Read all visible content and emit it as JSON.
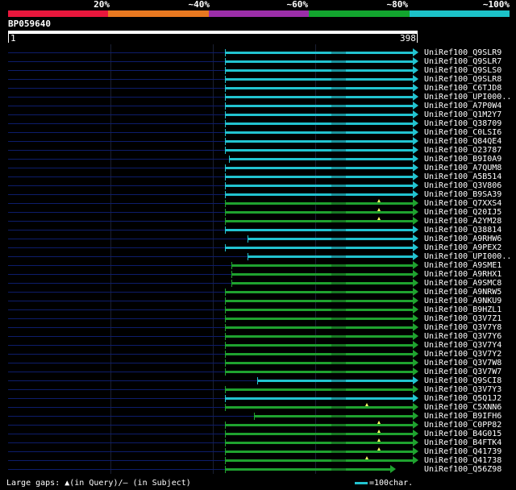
{
  "header": {
    "percent_labels": [
      "20%",
      "~40%",
      "~60%",
      "~80%",
      "~100%"
    ],
    "segment_colors": [
      "#e8173c",
      "#e87820",
      "#9b2ea8",
      "#12a52e",
      "#1cc2c8"
    ]
  },
  "query": {
    "id": "BP059640",
    "start": "1",
    "end": "398"
  },
  "colors": {
    "cyan": "#22c3d0",
    "green": "#1fa22f",
    "base": "#0d1d6b",
    "gap": "#ffff66"
  },
  "hits": [
    {
      "label": "UniRef100_Q9SLR9",
      "color": "cyan",
      "start": 0.53
    },
    {
      "label": "UniRef100_Q9SLR7",
      "color": "cyan",
      "start": 0.53
    },
    {
      "label": "UniRef100_Q9SLS0",
      "color": "cyan",
      "start": 0.53
    },
    {
      "label": "UniRef100_Q9SLR8",
      "color": "cyan",
      "start": 0.53
    },
    {
      "label": "UniRef100_C6TJD8",
      "color": "cyan",
      "start": 0.53
    },
    {
      "label": "UniRef100_UPI000..",
      "color": "cyan",
      "start": 0.53
    },
    {
      "label": "UniRef100_A7P0W4",
      "color": "cyan",
      "start": 0.53
    },
    {
      "label": "UniRef100_Q1M2Y7",
      "color": "cyan",
      "start": 0.53
    },
    {
      "label": "UniRef100_Q38709",
      "color": "cyan",
      "start": 0.53
    },
    {
      "label": "UniRef100_C0LSI6",
      "color": "cyan",
      "start": 0.53
    },
    {
      "label": "UniRef100_Q84QE4",
      "color": "cyan",
      "start": 0.53
    },
    {
      "label": "UniRef100_O23787",
      "color": "cyan",
      "start": 0.53
    },
    {
      "label": "UniRef100_B9I0A9",
      "color": "cyan",
      "start": 0.54
    },
    {
      "label": "UniRef100_A7QUM8",
      "color": "cyan",
      "start": 0.53
    },
    {
      "label": "UniRef100_A5B514",
      "color": "cyan",
      "start": 0.53
    },
    {
      "label": "UniRef100_Q3V806",
      "color": "cyan",
      "start": 0.53
    },
    {
      "label": "UniRef100_B9SA39",
      "color": "cyan",
      "start": 0.53
    },
    {
      "label": "UniRef100_Q7XXS4",
      "color": "green",
      "start": 0.53,
      "gap": 0.905
    },
    {
      "label": "UniRef100_Q20IJ5",
      "color": "green",
      "start": 0.53,
      "gap": 0.905
    },
    {
      "label": "UniRef100_A2YM28",
      "color": "green",
      "start": 0.53,
      "gap": 0.905
    },
    {
      "label": "UniRef100_Q38814",
      "color": "cyan",
      "start": 0.53
    },
    {
      "label": "UniRef100_A9RHW6",
      "color": "cyan",
      "start": 0.585
    },
    {
      "label": "UniRef100_A9PEX2",
      "color": "cyan",
      "start": 0.53
    },
    {
      "label": "UniRef100_UPI000..",
      "color": "cyan",
      "start": 0.585
    },
    {
      "label": "UniRef100_A9SME1",
      "color": "green",
      "start": 0.545
    },
    {
      "label": "UniRef100_A9RHX1",
      "color": "green",
      "start": 0.545
    },
    {
      "label": "UniRef100_A9SMC8",
      "color": "green",
      "start": 0.545
    },
    {
      "label": "UniRef100_A9NRW5",
      "color": "green",
      "start": 0.53
    },
    {
      "label": "UniRef100_A9NKU9",
      "color": "green",
      "start": 0.53
    },
    {
      "label": "UniRef100_B9HZL1",
      "color": "green",
      "start": 0.53
    },
    {
      "label": "UniRef100_Q3V7Z1",
      "color": "green",
      "start": 0.53
    },
    {
      "label": "UniRef100_Q3V7Y8",
      "color": "green",
      "start": 0.53
    },
    {
      "label": "UniRef100_Q3V7Y6",
      "color": "green",
      "start": 0.53
    },
    {
      "label": "UniRef100_Q3V7Y4",
      "color": "green",
      "start": 0.53
    },
    {
      "label": "UniRef100_Q3V7Y2",
      "color": "green",
      "start": 0.53
    },
    {
      "label": "UniRef100_Q3V7W8",
      "color": "green",
      "start": 0.53
    },
    {
      "label": "UniRef100_Q3V7W7",
      "color": "green",
      "start": 0.53
    },
    {
      "label": "UniRef100_Q9SCI8",
      "color": "cyan",
      "start": 0.608
    },
    {
      "label": "UniRef100_Q3V7Y3",
      "color": "green",
      "start": 0.53
    },
    {
      "label": "UniRef100_Q5Q1J2",
      "color": "cyan",
      "start": 0.53
    },
    {
      "label": "UniRef100_C5XNN6",
      "color": "green",
      "start": 0.53,
      "gap": 0.875
    },
    {
      "label": "UniRef100_B9IFH6",
      "color": "green",
      "start": 0.6
    },
    {
      "label": "UniRef100_C0PP82",
      "color": "green",
      "start": 0.53,
      "gap": 0.905
    },
    {
      "label": "UniRef100_B4G015",
      "color": "green",
      "start": 0.53,
      "gap": 0.905
    },
    {
      "label": "UniRef100_B4FTK4",
      "color": "green",
      "start": 0.53,
      "gap": 0.905
    },
    {
      "label": "UniRef100_Q41739",
      "color": "green",
      "start": 0.53,
      "gap": 0.905
    },
    {
      "label": "UniRef100_Q41738",
      "color": "green",
      "start": 0.53,
      "gap": 0.875
    },
    {
      "label": "UniRef100_Q56Z98",
      "color": "green",
      "start": 0.53,
      "end": 0.945
    }
  ],
  "legend": {
    "gaps_text": "Large gaps: ▲(in Query)/— (in Subject)",
    "scale_text": "=100char."
  }
}
